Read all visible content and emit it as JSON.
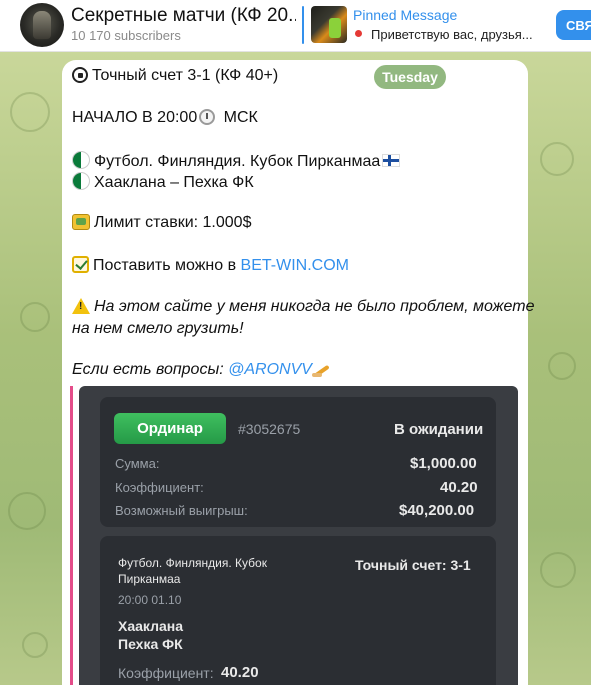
{
  "header": {
    "channel_title": "Секретные матчи (КФ 20...",
    "subscribers": "10 170 subscribers",
    "pinned_title": "Pinned Message",
    "pinned_text": "Приветствую вас, друзья...",
    "join_label": "СВЯ"
  },
  "message": {
    "line1": "Точный счет 3-1 (КФ 40+)",
    "date_pill": "Tuesday",
    "line2_a": "НАЧАЛО В 20:00",
    "line2_b": " МСК",
    "line3": "Футбол. Финляндия. Кубок Пирканмаа",
    "line4": "Хааклана – Пехка ФК",
    "line5": "Лимит ставки: 1.000$",
    "line6_a": "Поставить можно в ",
    "line6_link": "BET-WIN.COM",
    "line7": "На этом сайте у меня никогда не было проблем, можете",
    "line8": "на нем смело грузить!",
    "line9_a": "Если есть вопросы: ",
    "line9_link": "@ARONVV"
  },
  "bet_slip": {
    "type_label": "Ординар",
    "bet_id": "#3052675",
    "status": "В ожидании",
    "sum_label": "Сумма:",
    "sum_value": "$1,000.00",
    "coef_label": "Коэффициент:",
    "coef_value": "40.20",
    "win_label": "Возможный выигрыш:",
    "win_value": "$40,200.00",
    "event_line1": "Футбол. Финляндия. Кубок",
    "event_line2": "Пирканмаа",
    "event_time": "20:00 01.10",
    "team1": "Хааклана",
    "team2": "Пехка ФК",
    "outcome": "Точный счет: 3-1",
    "coef2_label": "Коэффициент:",
    "coef2_value": "40.20"
  }
}
